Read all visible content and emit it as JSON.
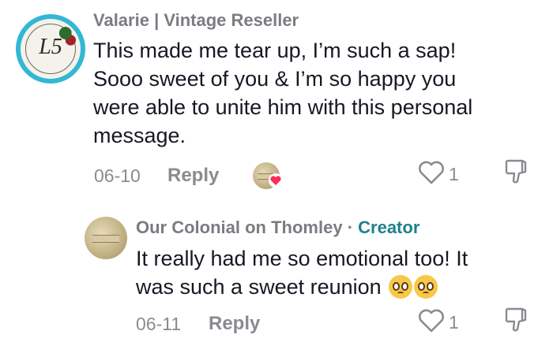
{
  "comment": {
    "author": "Valarie | Vintage Reseller",
    "avatar_monogram": "L5",
    "text_lines": [
      "This made me tear up, I’m such a sap!",
      "Sooo sweet of you & I’m so happy you",
      "were able to unite him with this personal",
      "message."
    ],
    "date": "06-10",
    "reply_label": "Reply",
    "like_count": "1",
    "icons": {
      "like": "heart-outline-icon",
      "dislike": "thumbs-down-icon",
      "creator_liked": "red-heart-badge-icon"
    }
  },
  "reply": {
    "author": "Our Colonial on Thomley",
    "separator": "·",
    "badge": "Creator",
    "text_lines": [
      "It really had me so emotional too! It",
      "was such a sweet reunion"
    ],
    "emojis": [
      "pleading-face-emoji",
      "pleading-face-emoji"
    ],
    "date": "06-11",
    "reply_label": "Reply",
    "like_count": "1",
    "icons": {
      "like": "heart-outline-icon",
      "dislike": "thumbs-down-icon"
    }
  },
  "colors": {
    "creator_badge": "#20808d",
    "avatar_ring": "#32b7d5",
    "liked_heart": "#fe2c55",
    "meta_text": "#8a8b91"
  }
}
